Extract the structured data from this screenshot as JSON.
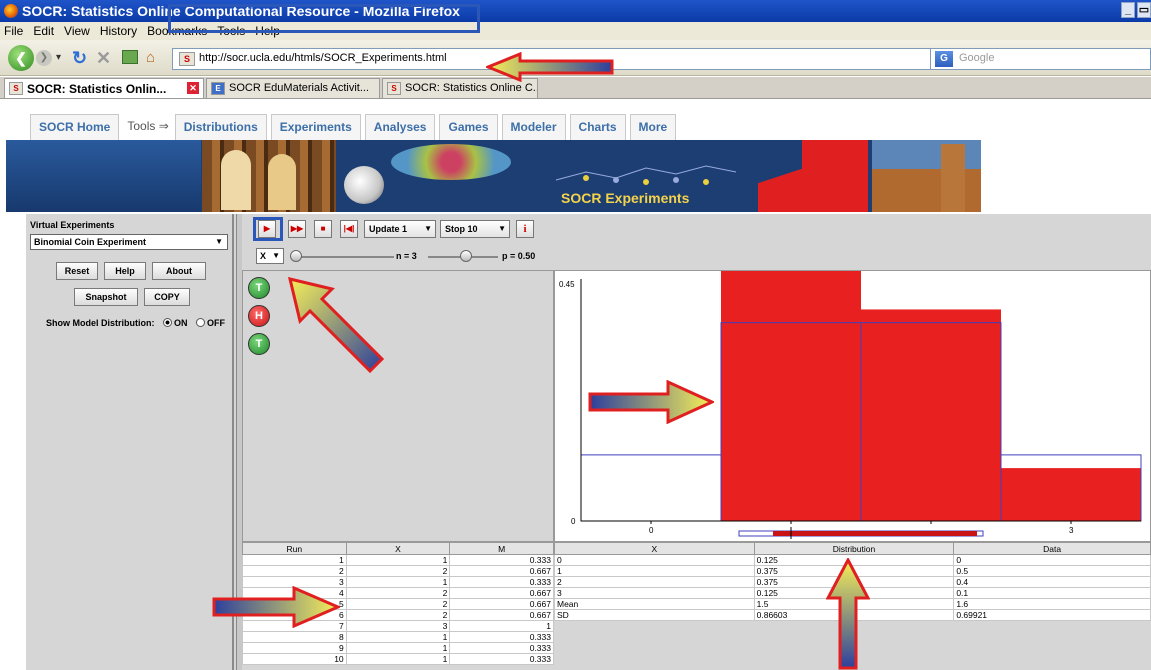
{
  "window": {
    "title": "SOCR: Statistics Online Computational Resource - Mozilla Firefox"
  },
  "menu": [
    "File",
    "Edit",
    "View",
    "History",
    "Bookmarks",
    "Tools",
    "Help"
  ],
  "nav": {
    "url": "http://socr.ucla.edu/htmls/SOCR_Experiments.html",
    "search_placeholder": "Google"
  },
  "browser_tabs": [
    {
      "label": "SOCR: Statistics Onlin...",
      "active": true
    },
    {
      "label": "SOCR EduMaterials Activit...",
      "active": false
    },
    {
      "label": "SOCR: Statistics Online C...",
      "active": false
    }
  ],
  "site_tabs": {
    "home": "SOCR Home",
    "tools": "Tools ⇒",
    "items": [
      "Distributions",
      "Experiments",
      "Analyses",
      "Games",
      "Modeler",
      "Charts",
      "More"
    ]
  },
  "banner": {
    "title": "SOCR Experiments"
  },
  "left_panel": {
    "title": "Virtual Experiments",
    "experiment": "Binomial Coin Experiment",
    "buttons": {
      "reset": "Reset",
      "help": "Help",
      "about": "About",
      "snapshot": "Snapshot",
      "copy": "COPY"
    },
    "show_model_label": "Show Model Distribution:",
    "on_label": "ON",
    "off_label": "OFF",
    "show_model": "ON"
  },
  "toolbar": {
    "update": "Update 1",
    "stop": "Stop 10",
    "info": "i"
  },
  "params": {
    "variable": "X",
    "n_label": "n = 3",
    "p_label": "p = 0.50",
    "n": 3,
    "p": 0.5
  },
  "coins": [
    "T",
    "H",
    "T"
  ],
  "chart_data": {
    "type": "bar",
    "x": [
      0,
      1,
      2,
      3
    ],
    "tick_labels": [
      "0",
      "",
      "",
      "3"
    ],
    "y_max_label": "0.45",
    "y_min_label": "0",
    "ylim": [
      0,
      0.45
    ],
    "series": [
      {
        "values": [
          0.0,
          0.5,
          0.4,
          0.1
        ],
        "color": "#e82020"
      },
      {
        "values": [
          0.125,
          0.375,
          0.375,
          0.125
        ],
        "color": "#4040c0"
      }
    ]
  },
  "run_table": {
    "headers": [
      "Run",
      "X",
      "M"
    ],
    "rows": [
      [
        "1",
        "1",
        "0.333"
      ],
      [
        "2",
        "2",
        "0.667"
      ],
      [
        "3",
        "1",
        "0.333"
      ],
      [
        "4",
        "2",
        "0.667"
      ],
      [
        "5",
        "2",
        "0.667"
      ],
      [
        "6",
        "2",
        "0.667"
      ],
      [
        "7",
        "3",
        "1"
      ],
      [
        "8",
        "1",
        "0.333"
      ],
      [
        "9",
        "1",
        "0.333"
      ],
      [
        "10",
        "1",
        "0.333"
      ]
    ]
  },
  "dist_table": {
    "headers": [
      "X",
      "Distribution",
      "Data"
    ],
    "rows": [
      [
        "0",
        "0.125",
        "0"
      ],
      [
        "1",
        "0.375",
        "0.5"
      ],
      [
        "2",
        "0.375",
        "0.4"
      ],
      [
        "3",
        "0.125",
        "0.1"
      ],
      [
        "Mean",
        "1.5",
        "1.6"
      ],
      [
        "SD",
        "0.86603",
        "0.69921"
      ]
    ]
  },
  "colors": {
    "highlight_box": "#2a57b8",
    "arrow_border": "#e02020",
    "bar_fill": "#e82020",
    "model_outline": "#4040c0"
  }
}
